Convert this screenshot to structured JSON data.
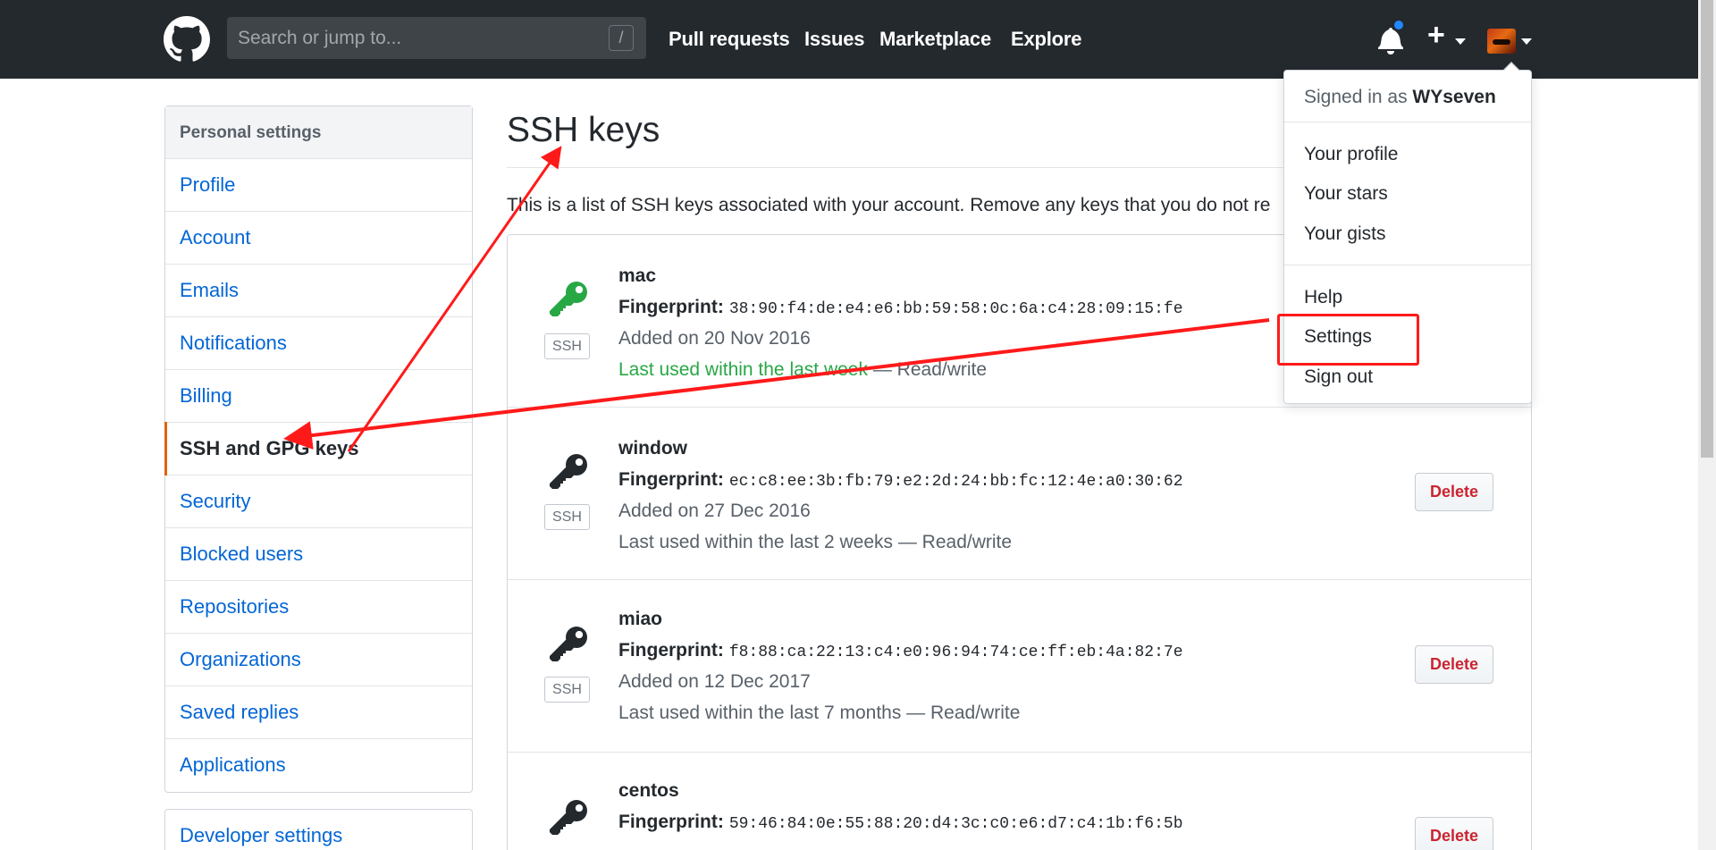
{
  "header": {
    "search": {
      "placeholder": "Search or jump to...",
      "shortcut": "/"
    },
    "nav": [
      {
        "label": "Pull requests"
      },
      {
        "label": "Issues"
      },
      {
        "label": "Marketplace"
      },
      {
        "label": "Explore"
      }
    ],
    "notification_color": "#2188ff",
    "plus": "+"
  },
  "sidebar": {
    "heading": "Personal settings",
    "items": [
      {
        "label": "Profile"
      },
      {
        "label": "Account"
      },
      {
        "label": "Emails"
      },
      {
        "label": "Notifications"
      },
      {
        "label": "Billing"
      },
      {
        "label": "SSH and GPG keys",
        "active": true
      },
      {
        "label": "Security"
      },
      {
        "label": "Blocked users"
      },
      {
        "label": "Repositories"
      },
      {
        "label": "Organizations"
      },
      {
        "label": "Saved replies"
      },
      {
        "label": "Applications"
      }
    ],
    "developer_settings": "Developer settings"
  },
  "main": {
    "title": "SSH keys",
    "intro": "This is a list of SSH keys associated with your account. Remove any keys that you do not re",
    "keys": [
      {
        "name": "mac",
        "fingerprint_label": "Fingerprint:",
        "fingerprint": "38:90:f4:de:e4:e6:bb:59:58:0c:6a:c4:28:09:15:fe",
        "added": "Added on 20 Nov 2016",
        "last_used_recent": "Last used within the last week",
        "last_used_suffix": " — Read/write",
        "badge": "SSH",
        "icon_color": "#28a745"
      },
      {
        "name": "window",
        "fingerprint_label": "Fingerprint:",
        "fingerprint": "ec:c8:ee:3b:fb:79:e2:2d:24:bb:fc:12:4e:a0:30:62",
        "added": "Added on 27 Dec 2016",
        "last_used": "Last used within the last 2 weeks — Read/write",
        "badge": "SSH",
        "delete": "Delete",
        "icon_color": "#24292e"
      },
      {
        "name": "miao",
        "fingerprint_label": "Fingerprint:",
        "fingerprint": "f8:88:ca:22:13:c4:e0:96:94:74:ce:ff:eb:4a:82:7e",
        "added": "Added on 12 Dec 2017",
        "last_used": "Last used within the last 7 months — Read/write",
        "badge": "SSH",
        "delete": "Delete",
        "icon_color": "#24292e"
      },
      {
        "name": "centos",
        "fingerprint_label": "Fingerprint:",
        "fingerprint": "59:46:84:0e:55:88:20:d4:3c:c0:e6:d7:c4:1b:f6:5b",
        "delete": "Delete",
        "icon_color": "#24292e"
      }
    ]
  },
  "user_menu": {
    "signed_in_prefix": "Signed in as ",
    "username": "WYseven",
    "items_1": [
      {
        "label": "Your profile"
      },
      {
        "label": "Your stars"
      },
      {
        "label": "Your gists"
      }
    ],
    "items_2": [
      {
        "label": "Help"
      },
      {
        "label": "Settings"
      },
      {
        "label": "Sign out"
      }
    ]
  },
  "annotation_color": "#ff1a1a"
}
